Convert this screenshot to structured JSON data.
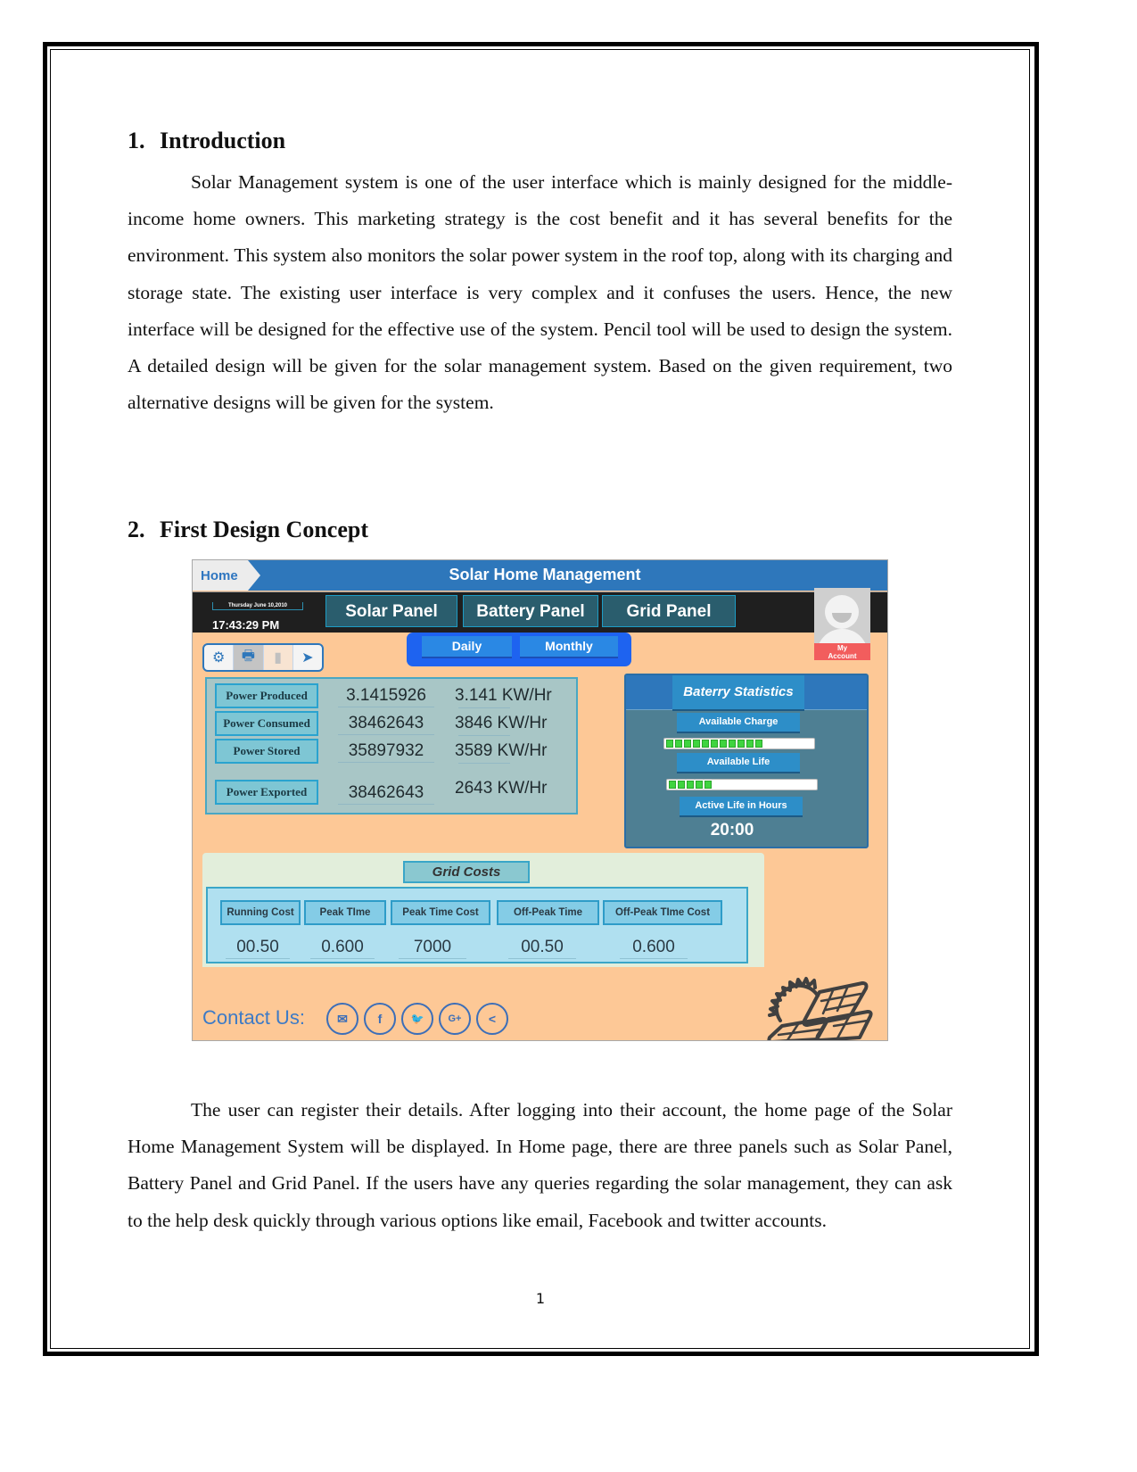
{
  "document": {
    "sections": [
      {
        "number": "1.",
        "heading": "Introduction",
        "paragraph": "Solar Management system is one of the user interface which is mainly designed for the middle-income home owners. This marketing strategy is the cost benefit and it has several benefits for the environment. This system also monitors the solar power system in the roof top, along with its charging and storage state. The existing user interface is very complex and it confuses the users. Hence, the new interface will be designed for the effective use of the system. Pencil tool will be used to design the system. A detailed design will be given for the solar management system. Based on the given requirement, two alternative designs will be given for the system."
      },
      {
        "number": "2.",
        "heading": "First Design Concept",
        "paragraph": "The user can register their details. After logging into their account, the home page of the Solar Home Management System will be displayed. In Home page, there are three panels such as Solar Panel, Battery Panel and Grid Panel. If the users have any queries regarding the solar management, they can ask to the help desk quickly through various options like email, Facebook and twitter accounts."
      }
    ],
    "page_number": "1"
  },
  "mockup": {
    "home_tab": "Home",
    "title": "Solar Home Management",
    "date": "Thursday June 10,2010",
    "time": "17:43:29 PM",
    "panels": [
      "Solar Panel",
      "Battery Panel",
      "Grid Panel"
    ],
    "account": {
      "line1": "My",
      "line2": "Account"
    },
    "toolbar": [
      {
        "icon": "gear-icon",
        "glyph": "⚙"
      },
      {
        "icon": "printer-icon",
        "glyph": "🖶"
      },
      {
        "icon": "trash-icon",
        "glyph": "▮"
      },
      {
        "icon": "send-icon",
        "glyph": "➤"
      }
    ],
    "period_tabs": [
      "Daily",
      "Monthly"
    ],
    "stats": [
      {
        "label": "Power Produced",
        "value": "3.1415926",
        "unit": "3.141 KW/Hr"
      },
      {
        "label": "Power Consumed",
        "value": "38462643",
        "unit": "3846 KW/Hr"
      },
      {
        "label": "Power Stored",
        "value": "35897932",
        "unit": "3589 KW/Hr"
      },
      {
        "label": "Power Exported",
        "value": "38462643",
        "unit": "2643 KW/Hr"
      }
    ],
    "battery": {
      "title": "Baterry Statistics",
      "available_charge_label": "Available Charge",
      "available_charge_segments": 11,
      "available_life_label": "Available Life",
      "available_life_segments": 5,
      "active_life_label": "Active Life in Hours",
      "active_life_value": "20:00"
    },
    "grid": {
      "title": "Grid Costs",
      "columns": [
        "Running Cost",
        "Peak TIme",
        "Peak Time Cost",
        "Off-Peak Time",
        "Off-Peak TIme Cost"
      ],
      "values": [
        "00.50",
        "0.600",
        "7000",
        "00.50",
        "0.600"
      ]
    },
    "contact": {
      "label": "Contact Us:",
      "icons": [
        {
          "icon": "email-icon",
          "glyph": "✉"
        },
        {
          "icon": "facebook-icon",
          "glyph": "f"
        },
        {
          "icon": "twitter-icon",
          "glyph": "🐦"
        },
        {
          "icon": "google-plus-icon",
          "glyph": "G+"
        },
        {
          "icon": "share-icon",
          "glyph": "<"
        }
      ]
    },
    "colors": {
      "primary_blue": "#2e77bb",
      "background_peach": "#fdc896",
      "alert_red": "#f25d5d",
      "charge_green": "#3fd43f"
    }
  }
}
